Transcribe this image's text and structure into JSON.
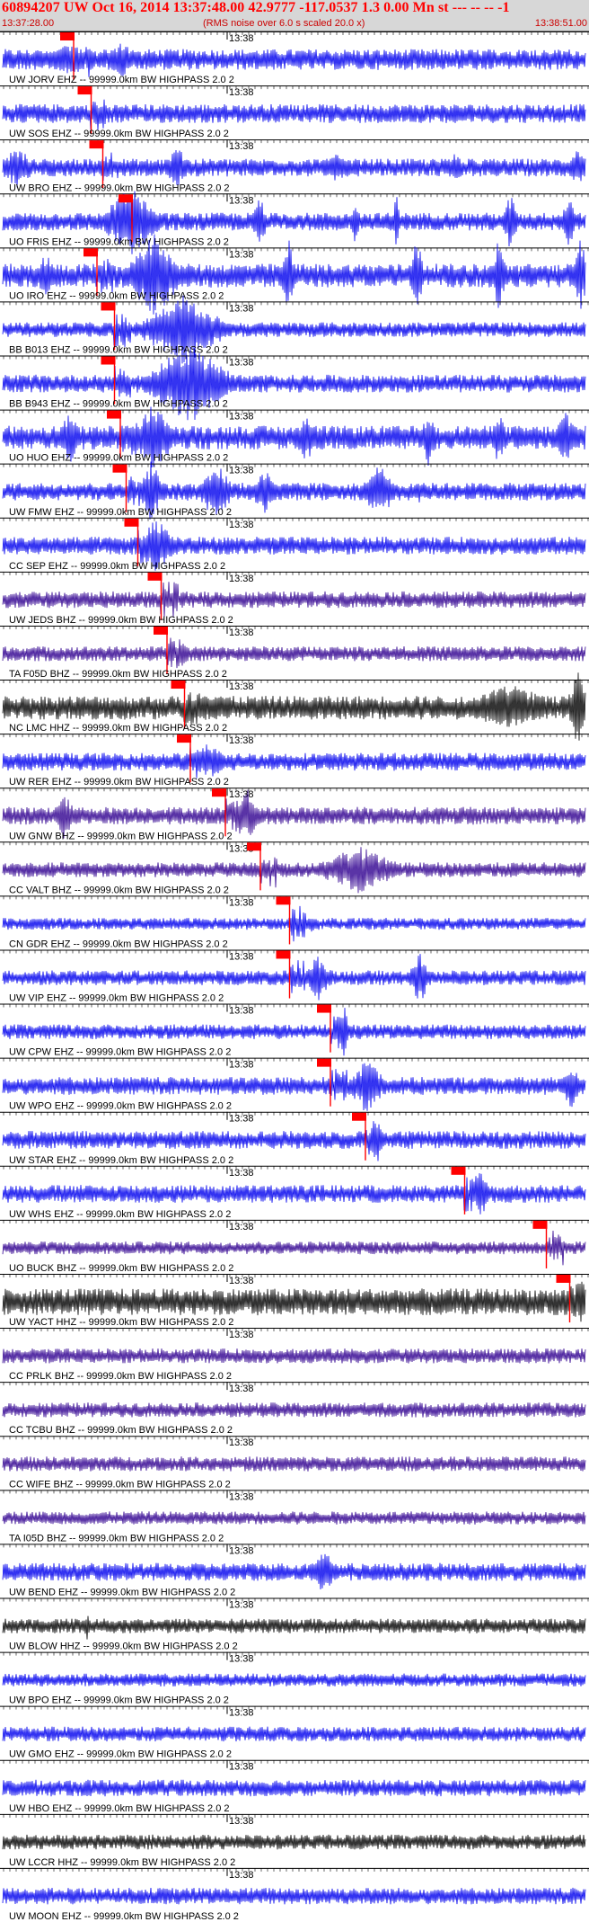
{
  "header": {
    "title": "60894207 UW Oct 16, 2014 13:37:48.00   42.9777 -117.0537  1.3 0.00 Mn st --- -- --  -1",
    "start_time": "13:37:28.00",
    "end_time": "13:38:51.00",
    "note": "(RMS noise over 6.0 s scaled 20.0 x)",
    "bg_color": "#d7d7d7",
    "text_color": "#ff0000"
  },
  "tick_label": "13:38",
  "pick_color": "#ff0000",
  "traces": [
    {
      "label": "UW JORV EHZ -- 99999.0km BW  HIGHPASS  2.0  2",
      "color": "#0000ee",
      "amp": 0.35,
      "pick": 0.12,
      "bursts": [
        [
          0.07,
          0.08,
          0.5
        ],
        [
          0.18,
          0.05,
          0.6
        ],
        [
          0.84,
          0.1,
          0.25
        ]
      ]
    },
    {
      "label": "UW SOS EHZ -- 99999.0km BW  HIGHPASS  2.0  2",
      "color": "#0000ee",
      "amp": 0.32,
      "pick": 0.15,
      "bursts": [
        [
          0.5,
          0.05,
          0.2
        ]
      ]
    },
    {
      "label": "UW BRO EHZ -- 99999.0km BW  HIGHPASS  2.0  2",
      "color": "#0000ee",
      "amp": 0.3,
      "pick": 0.17,
      "bursts": [
        [
          0.0,
          0.05,
          0.7
        ],
        [
          0.28,
          0.04,
          0.7
        ],
        [
          0.55,
          0.04,
          0.6
        ],
        [
          0.76,
          0.03,
          0.5
        ],
        [
          0.97,
          0.03,
          0.6
        ]
      ]
    },
    {
      "label": "UO FRIS EHZ -- 99999.0km BW  HIGHPASS  2.0  2",
      "color": "#0000ee",
      "amp": 0.3,
      "pick": 0.22,
      "bursts": [
        [
          0.18,
          0.08,
          1.2
        ],
        [
          0.43,
          0.02,
          1.0
        ],
        [
          0.6,
          0.01,
          1.0
        ],
        [
          0.67,
          0.01,
          1.0
        ],
        [
          0.86,
          0.02,
          1.0
        ],
        [
          0.96,
          0.02,
          1.0
        ]
      ]
    },
    {
      "label": "UO IRO EHZ -- 99999.0km BW  HIGHPASS  2.0  2",
      "color": "#0000ee",
      "amp": 0.4,
      "pick": 0.16,
      "bursts": [
        [
          0.22,
          0.08,
          1.4
        ],
        [
          0.06,
          0.03,
          0.8
        ],
        [
          0.48,
          0.02,
          1.3
        ],
        [
          0.7,
          0.02,
          1.3
        ],
        [
          0.84,
          0.02,
          1.3
        ],
        [
          0.98,
          0.02,
          1.3
        ]
      ]
    },
    {
      "label": "BB B013 EHZ -- 99999.0km BW  HIGHPASS  2.0  2",
      "color": "#0000ee",
      "amp": 0.25,
      "pick": 0.19,
      "bursts": [
        [
          0.25,
          0.12,
          1.2
        ]
      ]
    },
    {
      "label": "BB B943 EHZ -- 99999.0km BW  HIGHPASS  2.0  2",
      "color": "#0000ee",
      "amp": 0.3,
      "pick": 0.19,
      "bursts": [
        [
          0.26,
          0.12,
          1.4
        ]
      ]
    },
    {
      "label": "UO HUO EHZ -- 99999.0km BW  HIGHPASS  2.0  2",
      "color": "#0000ee",
      "amp": 0.4,
      "pick": 0.2,
      "bursts": [
        [
          0.23,
          0.06,
          1.2
        ],
        [
          0.1,
          0.03,
          0.9
        ],
        [
          0.5,
          0.04,
          0.8
        ],
        [
          0.72,
          0.02,
          1.0
        ],
        [
          0.84,
          0.02,
          1.0
        ],
        [
          0.95,
          0.03,
          1.0
        ]
      ]
    },
    {
      "label": "UW FMW EHZ -- 99999.0km BW  HIGHPASS  2.0  2",
      "color": "#0000ee",
      "amp": 0.3,
      "pick": 0.21,
      "bursts": [
        [
          0.24,
          0.03,
          1.1
        ],
        [
          0.34,
          0.05,
          1.0
        ],
        [
          0.43,
          0.04,
          0.8
        ],
        [
          0.62,
          0.05,
          0.9
        ],
        [
          0.7,
          0.03,
          0.4
        ]
      ]
    },
    {
      "label": "CC SEP EHZ -- 99999.0km BW  HIGHPASS  2.0  2",
      "color": "#0000ee",
      "amp": 0.3,
      "pick": 0.23,
      "bursts": [
        [
          0.24,
          0.05,
          1.0
        ]
      ]
    },
    {
      "label": "UW JEDS BHZ -- 99999.0km BW  HIGHPASS  2.0  2",
      "color": "#300090",
      "amp": 0.28,
      "pick": 0.27,
      "bursts": []
    },
    {
      "label": "TA F05D BHZ -- 99999.0km BW  HIGHPASS  2.0  2",
      "color": "#300090",
      "amp": 0.25,
      "pick": 0.28,
      "bursts": [
        [
          0.3,
          0.02,
          0.4
        ]
      ]
    },
    {
      "label": "NC LMC HHZ -- 99999.0km BW  HIGHPASS  2.0  2",
      "color": "#000000",
      "amp": 0.4,
      "pick": 0.31,
      "bursts": [
        [
          0.33,
          0.04,
          0.5
        ],
        [
          0.8,
          0.14,
          0.8
        ],
        [
          0.97,
          0.03,
          1.3
        ]
      ]
    },
    {
      "label": "UW RER EHZ -- 99999.0km BW  HIGHPASS  2.0  2",
      "color": "#0000ee",
      "amp": 0.3,
      "pick": 0.32,
      "bursts": [
        [
          0.33,
          0.06,
          0.5
        ]
      ]
    },
    {
      "label": "UW GNW BHZ -- 99999.0km BW  HIGHPASS  2.0  2",
      "color": "#300090",
      "amp": 0.3,
      "pick": 0.38,
      "bursts": [
        [
          0.09,
          0.03,
          0.8
        ],
        [
          0.4,
          0.04,
          0.9
        ]
      ]
    },
    {
      "label": "CC VALT BHZ -- 99999.0km BW  HIGHPASS  2.0  2",
      "color": "#300090",
      "amp": 0.25,
      "pick": 0.44,
      "bursts": [
        [
          0.55,
          0.12,
          0.8
        ]
      ]
    },
    {
      "label": "CN GDR EHZ -- 99999.0km BW  HIGHPASS  2.0  2",
      "color": "#0000ee",
      "amp": 0.2,
      "pick": 0.49,
      "bursts": [
        [
          0.04,
          0.05,
          0.2
        ],
        [
          0.52,
          0.02,
          0.3
        ]
      ]
    },
    {
      "label": "UW VIP EHZ -- 99999.0km BW  HIGHPASS  2.0  2",
      "color": "#0000ee",
      "amp": 0.25,
      "pick": 0.49,
      "bursts": [
        [
          0.52,
          0.04,
          0.8
        ],
        [
          0.7,
          0.03,
          0.9
        ]
      ]
    },
    {
      "label": "UW CPW EHZ -- 99999.0km BW  HIGHPASS  2.0  2",
      "color": "#0000ee",
      "amp": 0.25,
      "pick": 0.56,
      "bursts": [
        [
          0.58,
          0.01,
          1.0
        ]
      ]
    },
    {
      "label": "UW WPO EHZ -- 99999.0km BW  HIGHPASS  2.0  2",
      "color": "#0000ee",
      "amp": 0.3,
      "pick": 0.56,
      "bursts": [
        [
          0.6,
          0.05,
          1.0
        ],
        [
          0.96,
          0.03,
          0.8
        ]
      ]
    },
    {
      "label": "UW STAR EHZ -- 99999.0km BW  HIGHPASS  2.0  2",
      "color": "#0000ee",
      "amp": 0.3,
      "pick": 0.62,
      "bursts": [
        [
          0.63,
          0.02,
          0.9
        ]
      ]
    },
    {
      "label": "UW WHS EHZ -- 99999.0km BW  HIGHPASS  2.0  2",
      "color": "#0000ee",
      "amp": 0.3,
      "pick": 0.79,
      "bursts": [
        [
          0.81,
          0.02,
          0.9
        ]
      ]
    },
    {
      "label": "UO BUCK BHZ -- 99999.0km BW  HIGHPASS  2.0  2",
      "color": "#300090",
      "amp": 0.22,
      "pick": 0.93,
      "bursts": []
    },
    {
      "label": "UW YACT HHZ -- 99999.0km BW  HIGHPASS  2.0  2",
      "color": "#000000",
      "amp": 0.45,
      "pick": 0.97,
      "bursts": [
        [
          0.98,
          0.02,
          0.9
        ]
      ]
    },
    {
      "label": "CC PRLK BHZ -- 99999.0km BW  HIGHPASS  2.0  2",
      "color": "#300090",
      "amp": 0.25,
      "pick": null,
      "bursts": []
    },
    {
      "label": "CC TCBU BHZ -- 99999.0km BW  HIGHPASS  2.0  2",
      "color": "#300090",
      "amp": 0.25,
      "pick": null,
      "bursts": []
    },
    {
      "label": "CC WIFE BHZ -- 99999.0km BW  HIGHPASS  2.0  2",
      "color": "#300090",
      "amp": 0.25,
      "pick": null,
      "bursts": []
    },
    {
      "label": "TA I05D BHZ -- 99999.0km BW  HIGHPASS  2.0  2",
      "color": "#300090",
      "amp": 0.22,
      "pick": null,
      "bursts": []
    },
    {
      "label": "UW BEND EHZ -- 99999.0km BW  HIGHPASS  2.0  2",
      "color": "#0000ee",
      "amp": 0.3,
      "pick": null,
      "bursts": [
        [
          0.53,
          0.04,
          0.8
        ]
      ]
    },
    {
      "label": "UW BLOW HHZ -- 99999.0km BW  HIGHPASS  2.0  2",
      "color": "#000000",
      "amp": 0.25,
      "pick": null,
      "bursts": [
        [
          0.14,
          0.01,
          0.5
        ]
      ]
    },
    {
      "label": "UW BPO EHZ -- 99999.0km BW  HIGHPASS  2.0  2",
      "color": "#0000ee",
      "amp": 0.22,
      "pick": null,
      "bursts": []
    },
    {
      "label": "UW GMO EHZ -- 99999.0km BW  HIGHPASS  2.0  2",
      "color": "#0000ee",
      "amp": 0.25,
      "pick": null,
      "bursts": []
    },
    {
      "label": "UW HBO EHZ -- 99999.0km BW  HIGHPASS  2.0  2",
      "color": "#0000ee",
      "amp": 0.28,
      "pick": null,
      "bursts": []
    },
    {
      "label": "UW LCCR HHZ -- 99999.0km BW  HIGHPASS  2.0  2",
      "color": "#000000",
      "amp": 0.25,
      "pick": null,
      "bursts": []
    },
    {
      "label": "UW MOON EHZ -- 99999.0km BW  HIGHPASS  2.0  2",
      "color": "#0000ee",
      "amp": 0.28,
      "pick": null,
      "bursts": []
    }
  ]
}
